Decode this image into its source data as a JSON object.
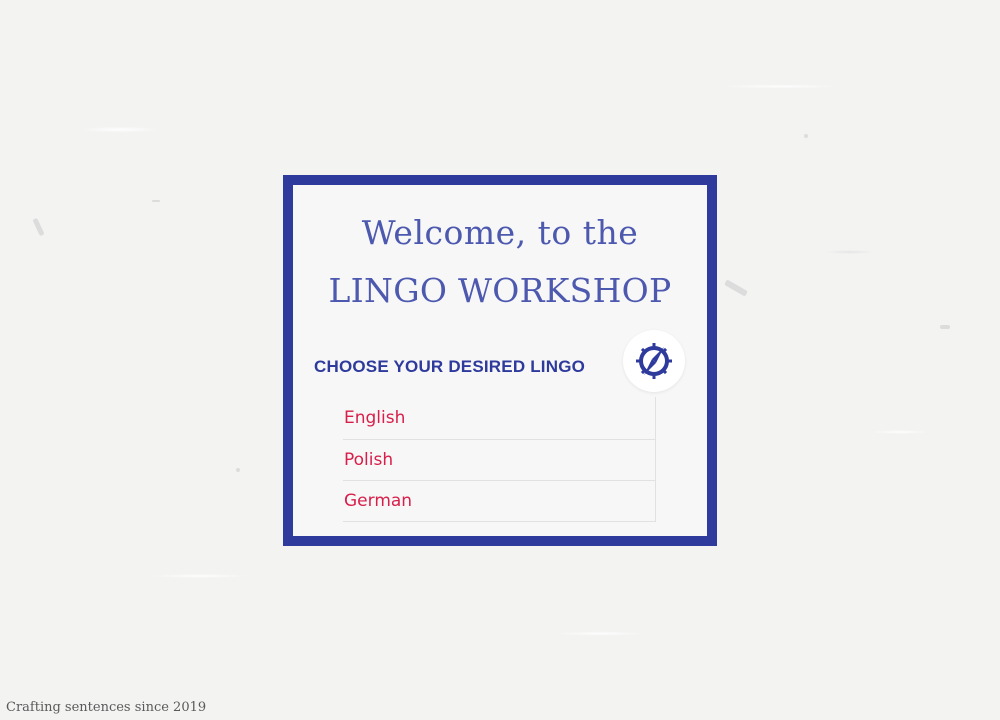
{
  "welcome": {
    "line1": "Welcome, to the",
    "line2": "LINGO WORKSHOP"
  },
  "section": {
    "title": "CHOOSE YOUR DESIRED LINGO",
    "icon": "compass-icon"
  },
  "languages": [
    {
      "label": "English"
    },
    {
      "label": "Polish"
    },
    {
      "label": "German"
    }
  ],
  "footer": {
    "text": "Crafting sentences since 2019"
  },
  "colors": {
    "primary": "#2e3a9c",
    "accent": "#d81e4a",
    "background": "#f3f3f2"
  }
}
